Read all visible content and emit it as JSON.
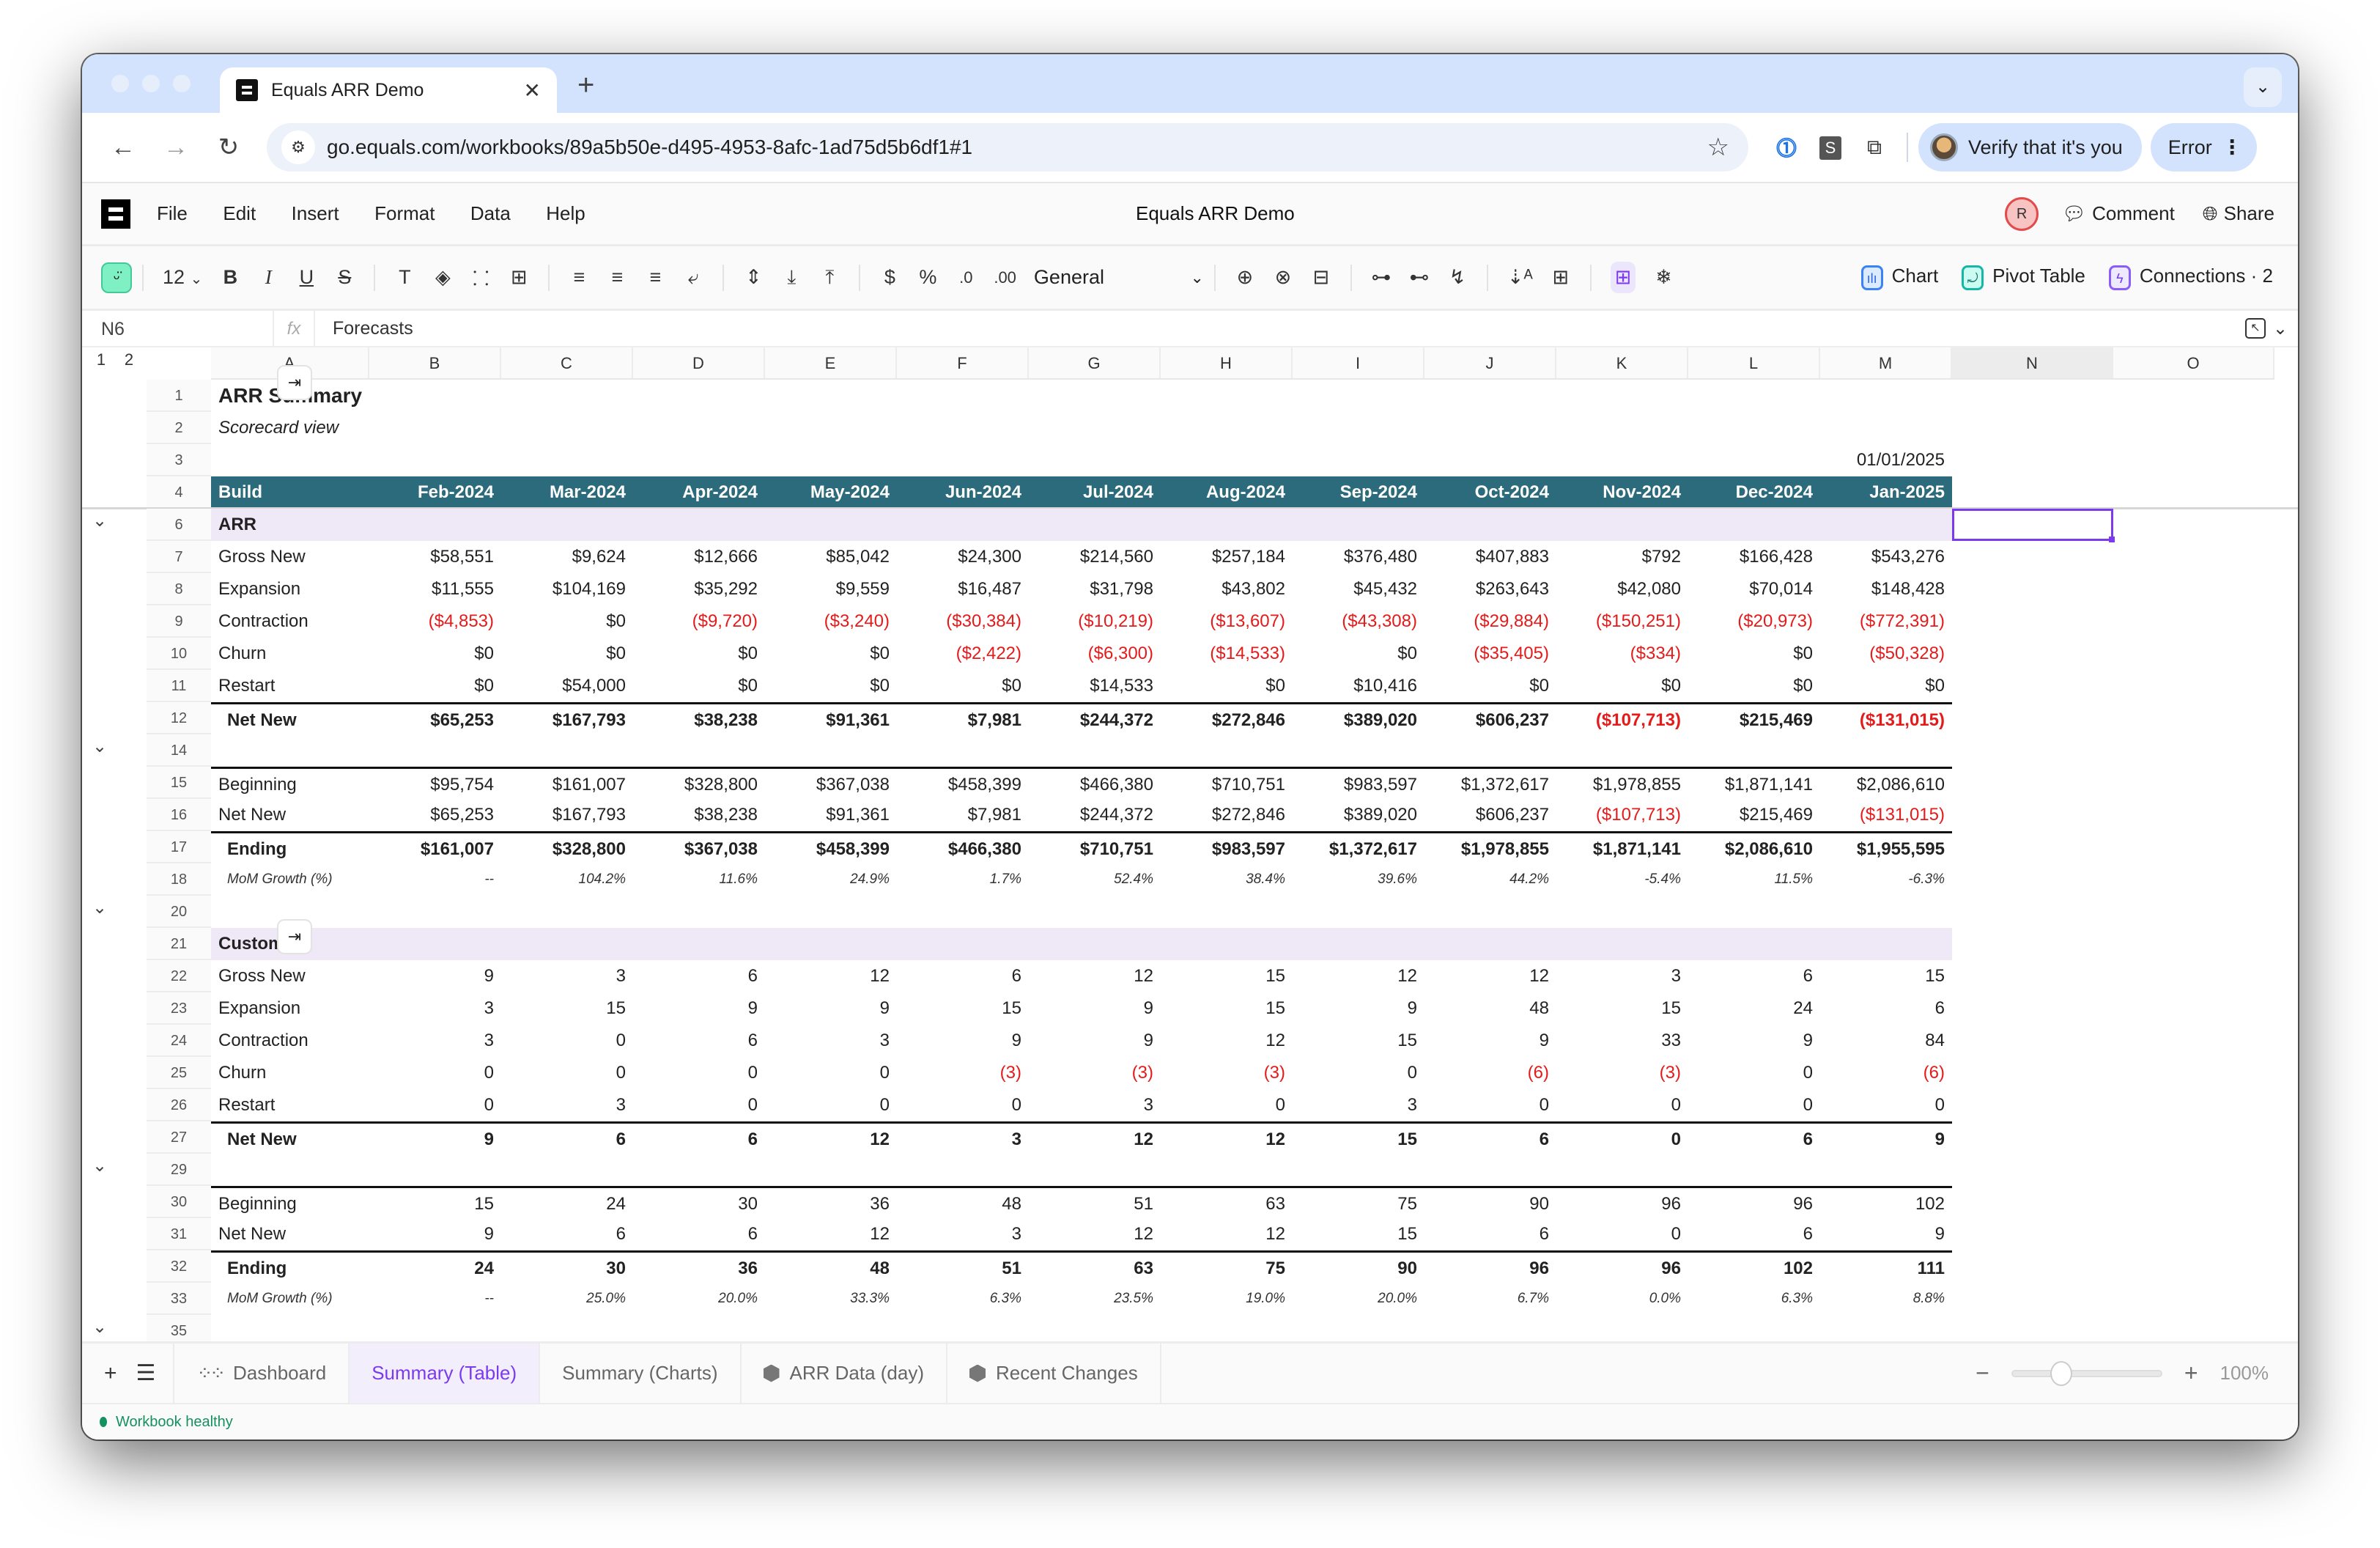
{
  "browser": {
    "tab_title": "Equals ARR Demo",
    "url": "go.equals.com/workbooks/89a5b50e-d495-4953-8afc-1ad75d5b6df1#1",
    "verify_label": "Verify that it's you",
    "error_label": "Error"
  },
  "app": {
    "menu": [
      "File",
      "Edit",
      "Insert",
      "Format",
      "Data",
      "Help"
    ],
    "doc_title": "Equals ARR Demo",
    "avatar_initial": "R",
    "comment_label": "Comment",
    "share_label": "Share"
  },
  "toolbar": {
    "font_size": "12",
    "currency": "$",
    "percent": "%",
    "dec_decrease": ".0",
    "dec_increase": ".00",
    "number_format": "General",
    "chart_label": "Chart",
    "pivot_label": "Pivot Table",
    "connections_label": "Connections · 2"
  },
  "formula_bar": {
    "cell_ref": "N6",
    "fx": "fx",
    "value": "Forecasts"
  },
  "grid": {
    "outline_levels": [
      "1",
      "2"
    ],
    "columns": [
      "A",
      "B",
      "C",
      "D",
      "E",
      "F",
      "G",
      "H",
      "I",
      "J",
      "K",
      "L",
      "M",
      "N",
      "O"
    ],
    "selected_column": "N",
    "selected_cell": "N6",
    "title": "ARR Summary",
    "subtitle": "Scorecard view",
    "as_of_date": "01/01/2025",
    "header_label": "Build",
    "months": [
      "Feb-2024",
      "Mar-2024",
      "Apr-2024",
      "May-2024",
      "Jun-2024",
      "Jul-2024",
      "Aug-2024",
      "Sep-2024",
      "Oct-2024",
      "Nov-2024",
      "Dec-2024",
      "Jan-2025"
    ],
    "rows": [
      {
        "n": "1",
        "type": "title",
        "label": "ARR Summary"
      },
      {
        "n": "2",
        "type": "subtitle",
        "label": "Scorecard view"
      },
      {
        "n": "3",
        "type": "date",
        "label": ""
      },
      {
        "n": "4",
        "type": "hdr",
        "label": "Build"
      },
      {
        "n": "6",
        "type": "section",
        "label": "ARR",
        "collapse": true
      },
      {
        "n": "7",
        "type": "data",
        "label": "Gross New",
        "values": [
          "$58,551",
          "$9,624",
          "$12,666",
          "$85,042",
          "$24,300",
          "$214,560",
          "$257,184",
          "$376,480",
          "$407,883",
          "$792",
          "$166,428",
          "$543,276"
        ]
      },
      {
        "n": "8",
        "type": "data",
        "label": "Expansion",
        "values": [
          "$11,555",
          "$104,169",
          "$35,292",
          "$9,559",
          "$16,487",
          "$31,798",
          "$43,802",
          "$45,432",
          "$263,643",
          "$42,080",
          "$70,014",
          "$148,428"
        ]
      },
      {
        "n": "9",
        "type": "data",
        "label": "Contraction",
        "values": [
          "($4,853)",
          "$0",
          "($9,720)",
          "($3,240)",
          "($30,384)",
          "($10,219)",
          "($13,607)",
          "($43,308)",
          "($29,884)",
          "($150,251)",
          "($20,973)",
          "($772,391)"
        ]
      },
      {
        "n": "10",
        "type": "data",
        "label": "Churn",
        "values": [
          "$0",
          "$0",
          "$0",
          "$0",
          "($2,422)",
          "($6,300)",
          "($14,533)",
          "$0",
          "($35,405)",
          "($334)",
          "$0",
          "($50,328)"
        ]
      },
      {
        "n": "11",
        "type": "data",
        "label": "Restart",
        "values": [
          "$0",
          "$54,000",
          "$0",
          "$0",
          "$0",
          "$14,533",
          "$0",
          "$10,416",
          "$0",
          "$0",
          "$0",
          "$0"
        ]
      },
      {
        "n": "12",
        "type": "total",
        "label": "Net New",
        "values": [
          "$65,253",
          "$167,793",
          "$38,238",
          "$91,361",
          "$7,981",
          "$244,372",
          "$272,846",
          "$389,020",
          "$606,237",
          "($107,713)",
          "$215,469",
          "($131,015)"
        ]
      },
      {
        "n": "14",
        "type": "blank",
        "label": "",
        "collapse": true
      },
      {
        "n": "15",
        "type": "data-top",
        "label": "Beginning",
        "values": [
          "$95,754",
          "$161,007",
          "$328,800",
          "$367,038",
          "$458,399",
          "$466,380",
          "$710,751",
          "$983,597",
          "$1,372,617",
          "$1,978,855",
          "$1,871,141",
          "$2,086,610"
        ]
      },
      {
        "n": "16",
        "type": "data",
        "label": "Net New",
        "values": [
          "$65,253",
          "$167,793",
          "$38,238",
          "$91,361",
          "$7,981",
          "$244,372",
          "$272,846",
          "$389,020",
          "$606,237",
          "($107,713)",
          "$215,469",
          "($131,015)"
        ]
      },
      {
        "n": "17",
        "type": "total",
        "label": "Ending",
        "values": [
          "$161,007",
          "$328,800",
          "$367,038",
          "$458,399",
          "$466,380",
          "$710,751",
          "$983,597",
          "$1,372,617",
          "$1,978,855",
          "$1,871,141",
          "$2,086,610",
          "$1,955,595"
        ]
      },
      {
        "n": "18",
        "type": "growth",
        "label": "MoM Growth (%)",
        "values": [
          "--",
          "104.2%",
          "11.6%",
          "24.9%",
          "1.7%",
          "52.4%",
          "38.4%",
          "39.6%",
          "44.2%",
          "-5.4%",
          "11.5%",
          "-6.3%"
        ]
      },
      {
        "n": "20",
        "type": "blank",
        "label": "",
        "collapse": true
      },
      {
        "n": "21",
        "type": "section",
        "label": "Customers"
      },
      {
        "n": "22",
        "type": "data",
        "label": "Gross New",
        "values": [
          "9",
          "3",
          "6",
          "12",
          "6",
          "12",
          "15",
          "12",
          "12",
          "3",
          "6",
          "15"
        ]
      },
      {
        "n": "23",
        "type": "data",
        "label": "Expansion",
        "values": [
          "3",
          "15",
          "9",
          "9",
          "15",
          "9",
          "15",
          "9",
          "48",
          "15",
          "24",
          "6"
        ]
      },
      {
        "n": "24",
        "type": "data",
        "label": "Contraction",
        "values": [
          "3",
          "0",
          "6",
          "3",
          "9",
          "9",
          "12",
          "15",
          "9",
          "33",
          "9",
          "84"
        ]
      },
      {
        "n": "25",
        "type": "data",
        "label": "Churn",
        "values": [
          "0",
          "0",
          "0",
          "0",
          "(3)",
          "(3)",
          "(3)",
          "0",
          "(6)",
          "(3)",
          "0",
          "(6)"
        ]
      },
      {
        "n": "26",
        "type": "data",
        "label": "Restart",
        "values": [
          "0",
          "3",
          "0",
          "0",
          "0",
          "3",
          "0",
          "3",
          "0",
          "0",
          "0",
          "0"
        ]
      },
      {
        "n": "27",
        "type": "total",
        "label": "Net New",
        "values": [
          "9",
          "6",
          "6",
          "12",
          "3",
          "12",
          "12",
          "15",
          "6",
          "0",
          "6",
          "9"
        ]
      },
      {
        "n": "29",
        "type": "blank",
        "label": "",
        "collapse": true
      },
      {
        "n": "30",
        "type": "data-top",
        "label": "Beginning",
        "values": [
          "15",
          "24",
          "30",
          "36",
          "48",
          "51",
          "63",
          "75",
          "90",
          "96",
          "96",
          "102"
        ]
      },
      {
        "n": "31",
        "type": "data",
        "label": "Net New",
        "values": [
          "9",
          "6",
          "6",
          "12",
          "3",
          "12",
          "12",
          "15",
          "6",
          "0",
          "6",
          "9"
        ]
      },
      {
        "n": "32",
        "type": "total",
        "label": "Ending",
        "values": [
          "24",
          "30",
          "36",
          "48",
          "51",
          "63",
          "75",
          "90",
          "96",
          "96",
          "102",
          "111"
        ]
      },
      {
        "n": "33",
        "type": "growth",
        "label": "MoM Growth (%)",
        "values": [
          "--",
          "25.0%",
          "20.0%",
          "33.3%",
          "6.3%",
          "23.5%",
          "19.0%",
          "20.0%",
          "6.7%",
          "0.0%",
          "6.3%",
          "8.8%"
        ]
      },
      {
        "n": "35",
        "type": "blank",
        "label": "",
        "collapse": true
      }
    ]
  },
  "sheets": {
    "tabs": [
      {
        "label": "Dashboard",
        "icon": "dashboard-icon",
        "active": false
      },
      {
        "label": "Summary (Table)",
        "icon": "",
        "active": true
      },
      {
        "label": "Summary (Charts)",
        "icon": "",
        "active": false
      },
      {
        "label": "ARR Data (day)",
        "icon": "query-icon",
        "active": false
      },
      {
        "label": "Recent Changes",
        "icon": "query-icon",
        "active": false
      }
    ],
    "zoom_percent": "100%",
    "zoom_slider_fraction": 0.33
  },
  "status": {
    "text": "Workbook healthy"
  },
  "colors": {
    "accent": "#7c3aed",
    "header_fill": "#2c6b7c",
    "section_fill": "#efe8f7",
    "negative": "#e41b1b",
    "healthy": "#15915f"
  }
}
